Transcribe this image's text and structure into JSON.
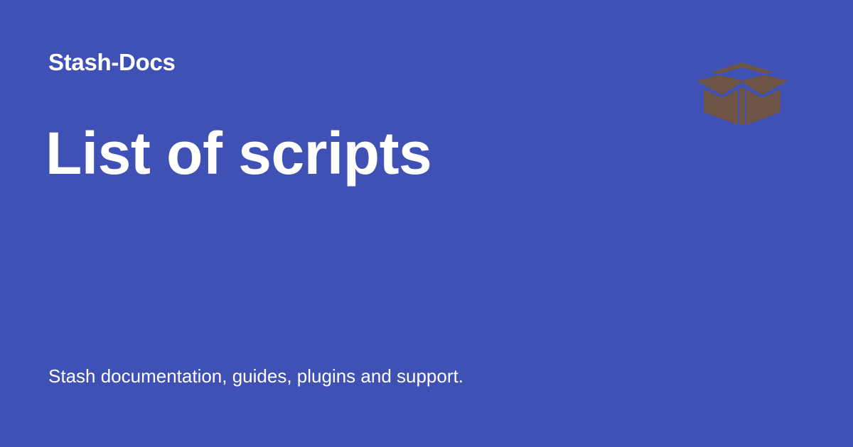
{
  "site": {
    "name": "Stash-Docs",
    "logo_icon": "open-box-icon",
    "logo_color": "#6d5444"
  },
  "page": {
    "title": "List of scripts",
    "description": "Stash documentation, guides, plugins and support."
  },
  "theme": {
    "background": "#3f51b5",
    "text": "#ffffff"
  }
}
